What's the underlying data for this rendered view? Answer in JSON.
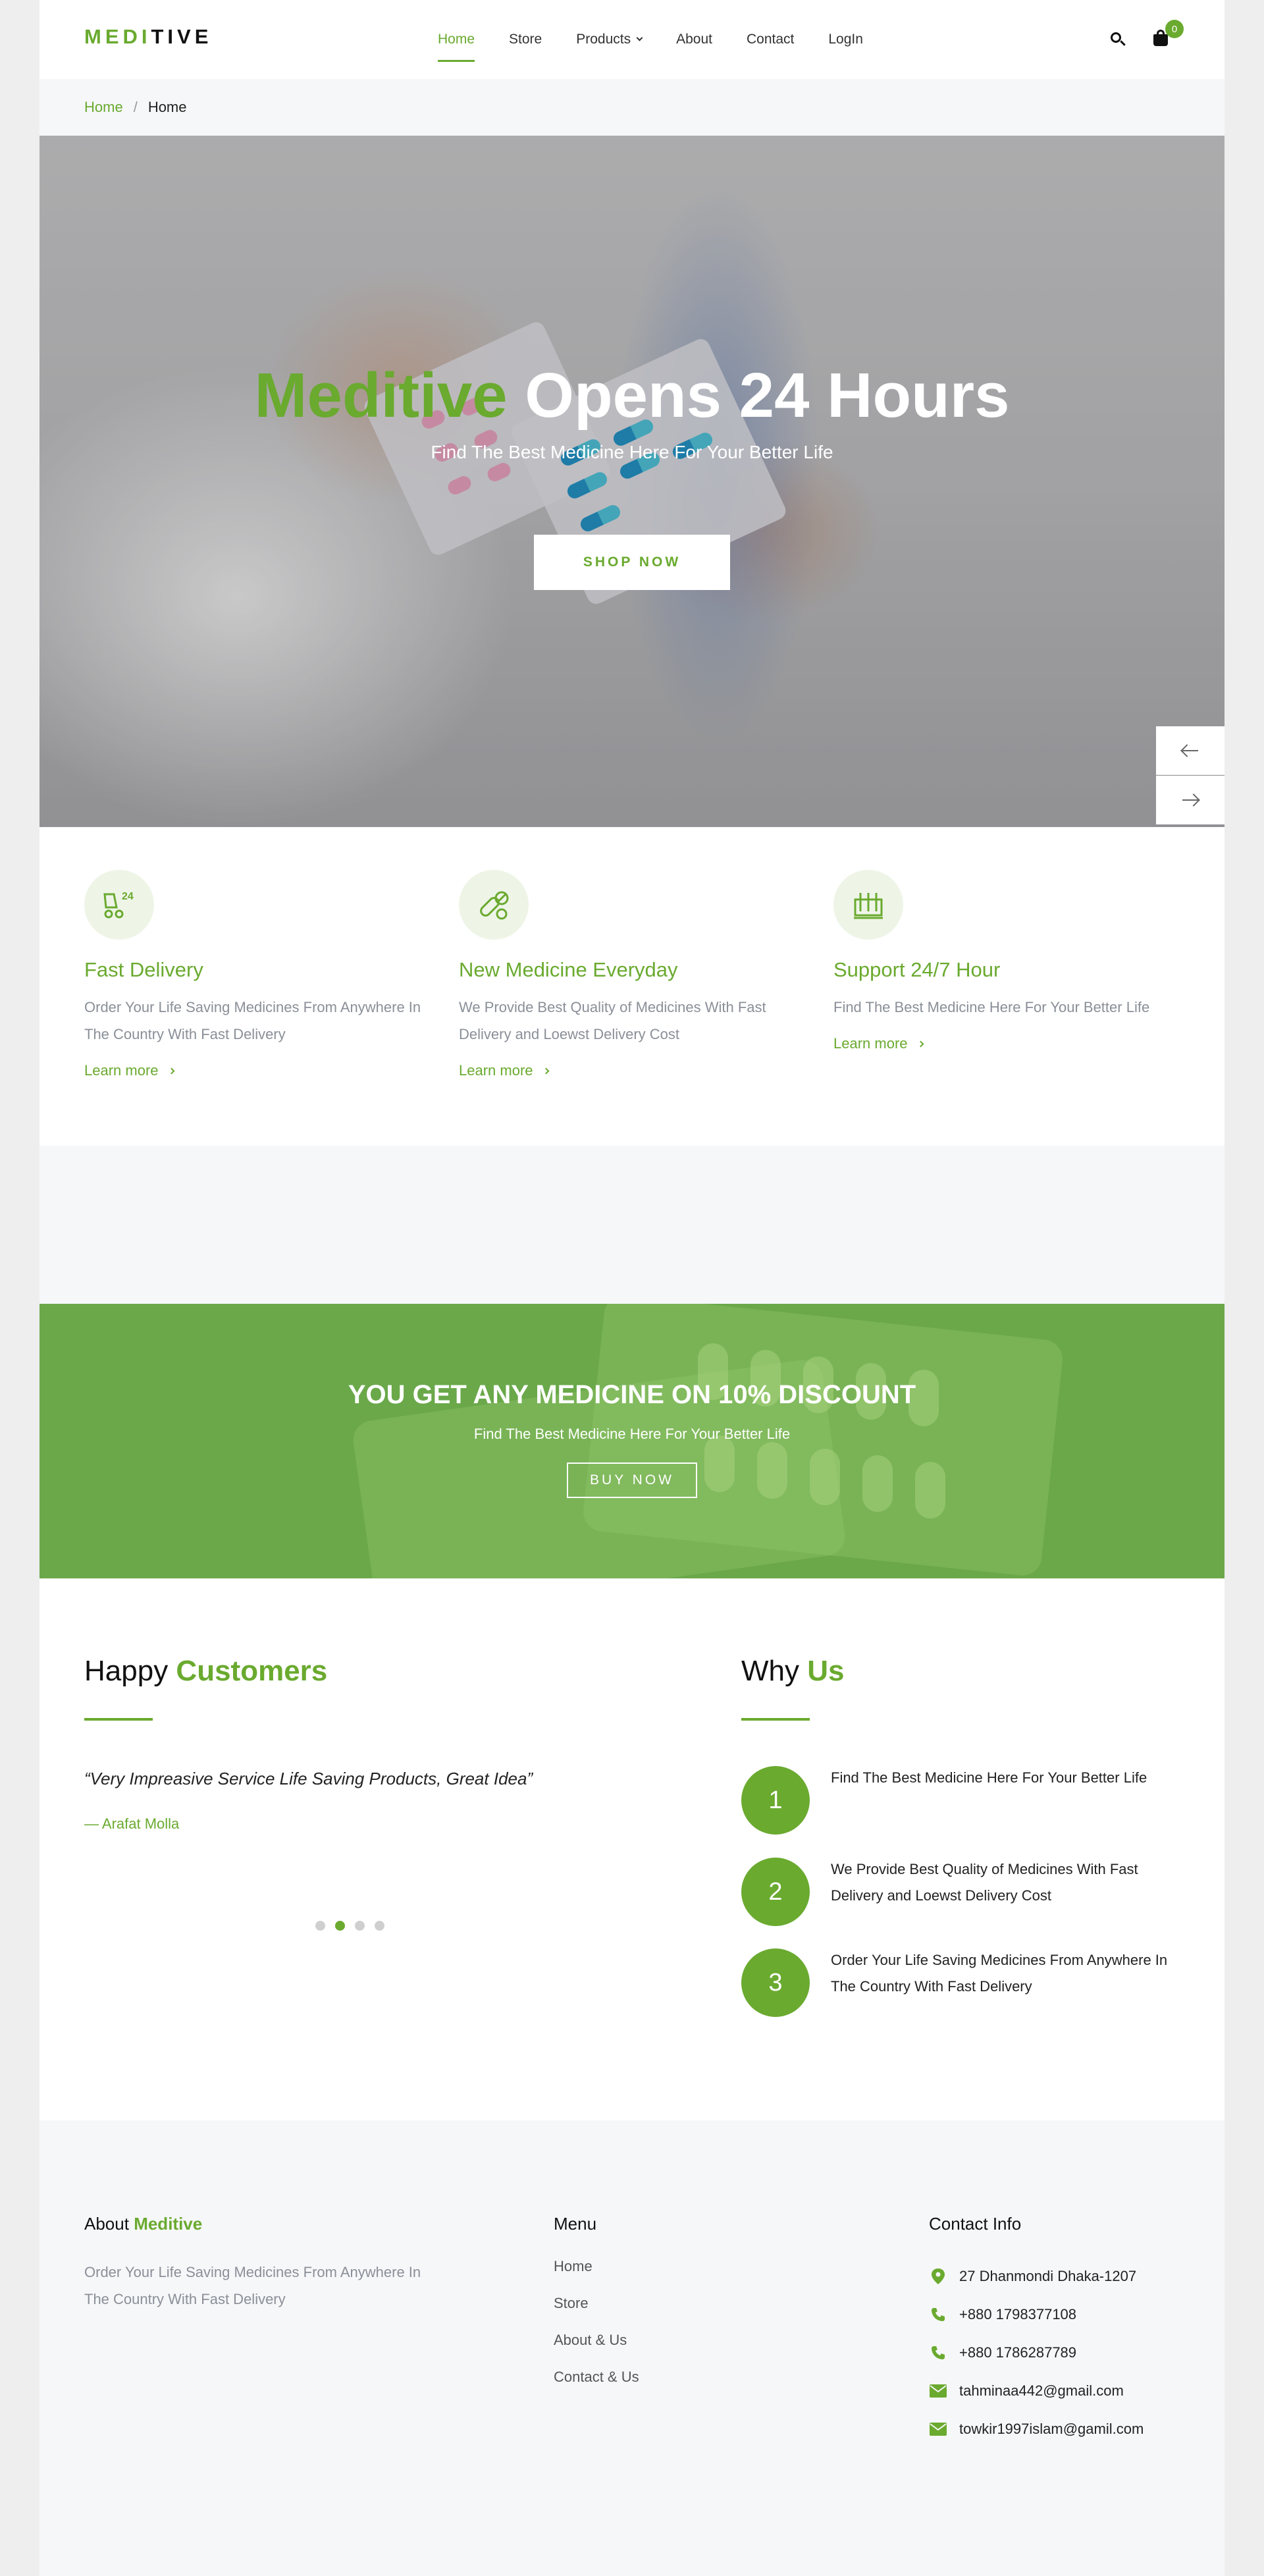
{
  "header": {
    "logo_part1": "MEDI",
    "logo_part2": "TIVE",
    "nav": [
      "Home",
      "Store",
      "Products",
      "About",
      "Contact",
      "LogIn"
    ],
    "cart_count": "0",
    "accent": "#6aaa2f"
  },
  "breadcrumb": {
    "home": "Home",
    "separator": "/",
    "current": "Home"
  },
  "hero": {
    "title_highlight": "Meditive",
    "title_rest": "Opens 24 Hours",
    "subtitle": "Find The Best Medicine Here For Your Better Life",
    "button": "SHOP NOW"
  },
  "features": [
    {
      "icon": "delivery-24-icon",
      "title": "Fast Delivery",
      "description": "Order Your Life Saving Medicines From Anywhere In The Country With Fast Delivery",
      "link": "Learn more"
    },
    {
      "icon": "medicine-pills-icon",
      "title": "New Medicine Everyday",
      "description": "We Provide Best Quality of Medicines With Fast Delivery and Loewst Delivery Cost",
      "link": "Learn more"
    },
    {
      "icon": "support-lab-icon",
      "title": "Support 24/7 Hour",
      "description": "Find The Best Medicine Here For Your Better Life",
      "link": "Learn more"
    }
  ],
  "discount": {
    "title": "YOU GET ANY MEDICINE ON 10% DISCOUNT",
    "subtitle": "Find The Best Medicine Here For Your Better Life",
    "button": "BUY NOW"
  },
  "testimonials": {
    "title_plain": "Happy",
    "title_highlight": "Customers",
    "quote": "“Very Impreasive Service Life Saving Products, Great Idea”",
    "author": "— Arafat Molla",
    "dot_count": 4,
    "active_dot": 2
  },
  "why_us": {
    "title_plain": "Why",
    "title_highlight": "Us",
    "items": [
      {
        "number": "1",
        "text": "Find The Best Medicine Here For Your Better Life"
      },
      {
        "number": "2",
        "text": "We Provide Best Quality of Medicines With Fast Delivery and Loewst Delivery Cost"
      },
      {
        "number": "3",
        "text": "Order Your Life Saving Medicines From Anywhere In The Country With Fast Delivery"
      }
    ]
  },
  "footer": {
    "about_title_plain": "About",
    "about_title_highlight": "Meditive",
    "about_text": "Order Your Life Saving Medicines From Anywhere In The Country With Fast Delivery",
    "menu_title": "Menu",
    "menu": [
      "Home",
      "Store",
      "About & Us",
      "Contact & Us"
    ],
    "contact_title": "Contact Info",
    "contacts": [
      {
        "icon": "location-pin-icon",
        "text": "27 Dhanmondi Dhaka-1207"
      },
      {
        "icon": "phone-icon",
        "text": "+880 1798377108"
      },
      {
        "icon": "phone-icon",
        "text": "+880 1786287789"
      },
      {
        "icon": "email-icon",
        "text": "tahminaa442@gmail.com"
      },
      {
        "icon": "email-icon",
        "text": "towkir1997islam@gamil.com"
      }
    ]
  }
}
